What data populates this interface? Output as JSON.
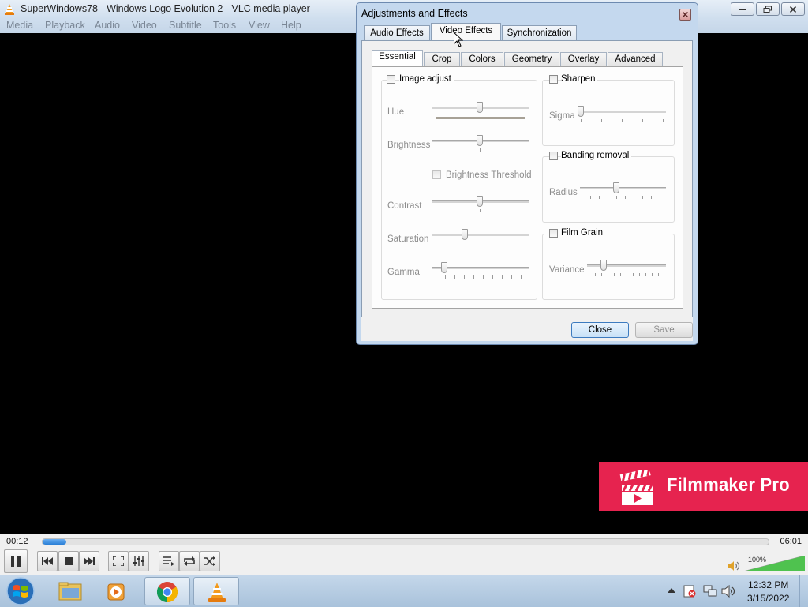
{
  "window": {
    "title": "SuperWindows78 - Windows Logo Evolution 2 - VLC media player",
    "menu": [
      "Media",
      "Playback",
      "Audio",
      "Video",
      "Subtitle",
      "Tools",
      "View",
      "Help"
    ]
  },
  "watermark": {
    "text": "Filmmaker Pro",
    "color": "#e6234f"
  },
  "player": {
    "time_elapsed": "00:12",
    "time_total": "06:01",
    "progress": 0.033,
    "volume_label": "100%",
    "volume": 1.0
  },
  "dialog": {
    "title": "Adjustments and Effects",
    "tabs": [
      "Audio Effects",
      "Video Effects",
      "Synchronization"
    ],
    "selected_tab": "Video Effects",
    "inner_tabs": [
      "Essential",
      "Crop",
      "Colors",
      "Geometry",
      "Overlay",
      "Advanced"
    ],
    "selected_inner_tab": "Essential",
    "image_adjust": {
      "label": "Image adjust",
      "checked": false,
      "hue_label": "Hue",
      "brightness_label": "Brightness",
      "brightness_threshold_label": "Brightness Threshold",
      "contrast_label": "Contrast",
      "saturation_label": "Saturation",
      "gamma_label": "Gamma"
    },
    "sharpen": {
      "label": "Sharpen",
      "checked": false,
      "sigma_label": "Sigma"
    },
    "banding_removal": {
      "label": "Banding removal",
      "checked": false,
      "radius_label": "Radius"
    },
    "film_grain": {
      "label": "Film Grain",
      "checked": false,
      "variance_label": "Variance"
    },
    "close_label": "Close",
    "save_label": "Save"
  },
  "taskbar": {
    "clock_time": "12:32 PM",
    "clock_date": "3/15/2022"
  },
  "colors": {
    "accent": "#2a7fd6",
    "dialog_frame": "#c4d8ee"
  }
}
